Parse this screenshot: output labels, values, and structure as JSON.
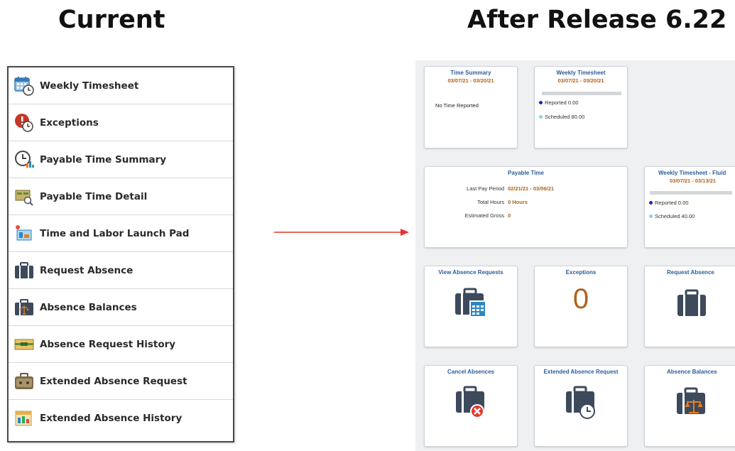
{
  "headings": {
    "current": "Current",
    "after": "After Release 6.22"
  },
  "menu": {
    "items": [
      {
        "label": "Weekly Timesheet",
        "icon": "calendar-clock-icon"
      },
      {
        "label": "Exceptions",
        "icon": "exception-alert-icon"
      },
      {
        "label": "Payable Time Summary",
        "icon": "clock-chart-icon"
      },
      {
        "label": "Payable Time Detail",
        "icon": "detail-search-icon"
      },
      {
        "label": "Time and Labor Launch Pad",
        "icon": "launch-pad-icon"
      },
      {
        "label": "Request Absence",
        "icon": "briefcase-icon"
      },
      {
        "label": "Absence Balances",
        "icon": "briefcase-scale-icon"
      },
      {
        "label": "Absence Request History",
        "icon": "history-folder-icon"
      },
      {
        "label": "Extended Absence Request",
        "icon": "briefcase-extended-icon"
      },
      {
        "label": "Extended Absence History",
        "icon": "history-chart-icon"
      }
    ]
  },
  "tiles": {
    "time_summary": {
      "title": "Time Summary",
      "date": "03/07/21 - 03/20/21",
      "text": "No Time Reported"
    },
    "weekly_timesheet": {
      "title": "Weekly Timesheet",
      "date": "03/07/21 - 03/20/21",
      "reported": "Reported 0.00",
      "scheduled": "Scheduled 80.00",
      "reported_fraction": 0
    },
    "payable_time": {
      "title": "Payable Time",
      "rows": [
        {
          "label": "Last Pay Period",
          "value": "02/21/21 - 03/06/21"
        },
        {
          "label": "Total Hours",
          "value": "0 Hours"
        },
        {
          "label": "Estimated Gross",
          "value": "0"
        }
      ]
    },
    "weekly_timesheet_fluid": {
      "title": "Weekly Timesheet - Fluid",
      "date": "03/07/21 - 03/13/21",
      "reported": "Reported 0.00",
      "scheduled": "Scheduled 40.00",
      "reported_fraction": 0
    },
    "view_absence_requests": {
      "title": "View Absence Requests",
      "icon": "briefcase-calendar-icon"
    },
    "exceptions": {
      "title": "Exceptions",
      "count": "0"
    },
    "request_absence": {
      "title": "Request Absence",
      "icon": "briefcase-icon"
    },
    "cancel_absences": {
      "title": "Cancel Absences",
      "icon": "briefcase-cancel-icon"
    },
    "extended_absence_request": {
      "title": "Extended Absence Request",
      "icon": "briefcase-clock-icon"
    },
    "absence_balances": {
      "title": "Absence Balances",
      "icon": "briefcase-scale-icon"
    }
  },
  "colors": {
    "reported_dot": "#1a22c8",
    "scheduled_dot": "#8fd0e8",
    "accent": "#b0621d",
    "title_blue": "#2b5d9b",
    "arrow": "#e8332f"
  }
}
